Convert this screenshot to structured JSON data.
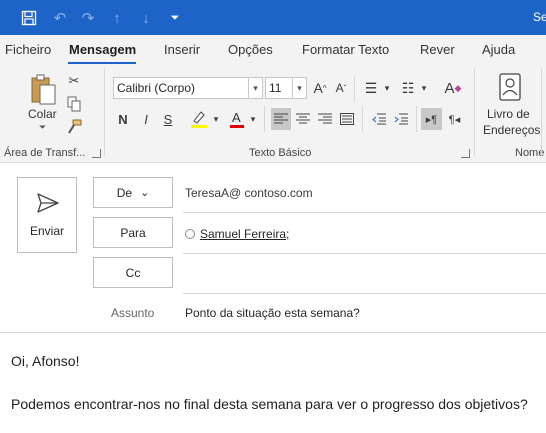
{
  "titlebar": {
    "title": "Se",
    "quick_access": [
      "save-icon",
      "undo-icon",
      "redo-icon",
      "arrow-up-icon",
      "arrow-down-icon",
      "customize-icon"
    ]
  },
  "tabs": [
    {
      "label": "Ficheiro",
      "active": false
    },
    {
      "label": "Mensagem",
      "active": true
    },
    {
      "label": "Inserir",
      "active": false
    },
    {
      "label": "Opções",
      "active": false
    },
    {
      "label": "Formatar Texto",
      "active": false
    },
    {
      "label": "Rever",
      "active": false
    },
    {
      "label": "Ajuda",
      "active": false
    }
  ],
  "ribbon": {
    "clipboard": {
      "paste_label": "Colar",
      "group_label": "Área de Transf..."
    },
    "basic_text": {
      "font_name": "Calibri (Corpo)",
      "font_size": "11",
      "bold": "N",
      "italic": "I",
      "underline": "S",
      "group_label": "Texto Básico"
    },
    "names": {
      "address_book_label_1": "Livro de",
      "address_book_label_2": "Endereços",
      "group_label": "Nome"
    }
  },
  "compose": {
    "send_label": "Enviar",
    "from_button": "De",
    "from_value": "TeresaA@ contoso.com",
    "to_button": "Para",
    "to_value": "Samuel Ferreira;",
    "cc_button": "Cc",
    "subject_label": "Assunto",
    "subject_value": "Ponto da situação esta semana?",
    "body": [
      "Oi, Afonso!",
      "Podemos encontrar-nos no final desta semana para ver o progresso dos objetivos?"
    ]
  },
  "colors": {
    "accent": "#1e64c8",
    "highlight": "#ffff00",
    "font_color": "#e00000"
  }
}
